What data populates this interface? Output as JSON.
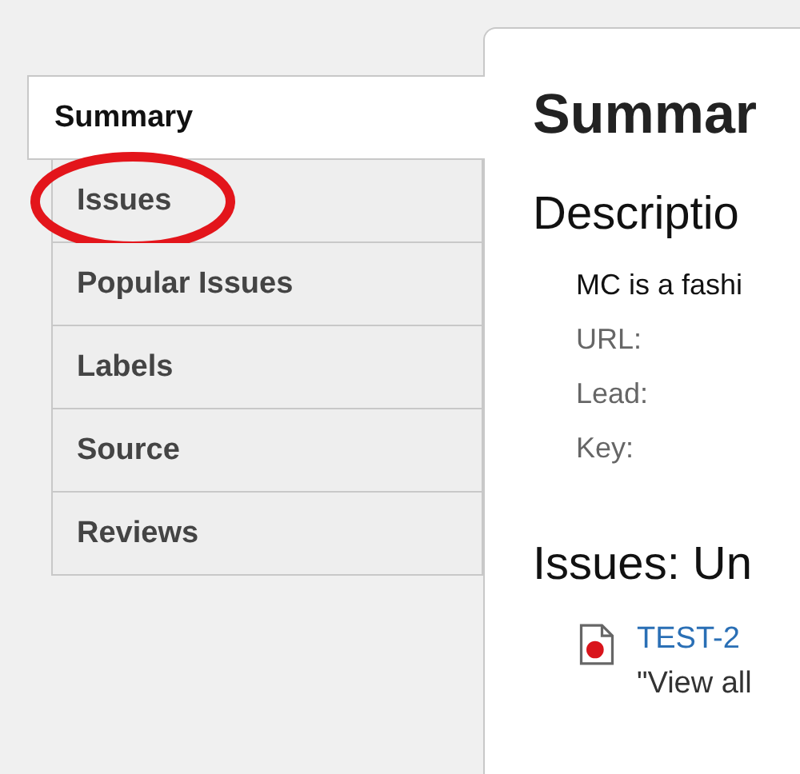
{
  "sidebar": {
    "tabs": [
      {
        "label": "Summary",
        "selected": true,
        "circled": false
      },
      {
        "label": "Issues",
        "selected": false,
        "circled": true
      },
      {
        "label": "Popular Issues",
        "selected": false,
        "circled": false
      },
      {
        "label": "Labels",
        "selected": false,
        "circled": false
      },
      {
        "label": "Source",
        "selected": false,
        "circled": false
      },
      {
        "label": "Reviews",
        "selected": false,
        "circled": false
      }
    ]
  },
  "content": {
    "title": "Summar",
    "description_heading": "Descriptio",
    "description": "MC is a fashi",
    "fields": [
      "URL:",
      "Lead:",
      "Key:"
    ],
    "issues_heading": "Issues: Un",
    "issues": [
      {
        "key": "TEST-2",
        "summary": "\"View all"
      }
    ]
  }
}
